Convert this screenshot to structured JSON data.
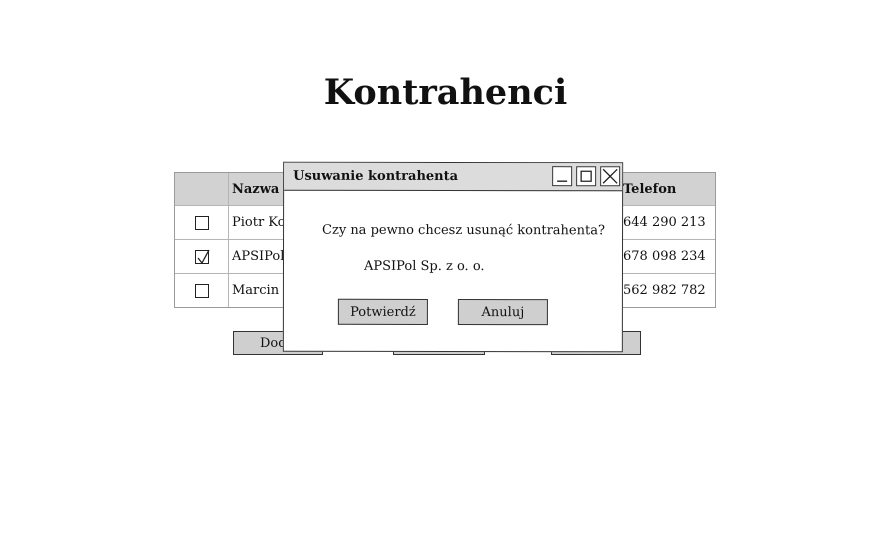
{
  "page": {
    "title": "Kontrahenci"
  },
  "table": {
    "headers": {
      "name": "Nazwa",
      "phone": "Telefon"
    },
    "rows": [
      {
        "checked": false,
        "name": "Piotr Kow",
        "phone": "644 290 213"
      },
      {
        "checked": true,
        "name": "APSIPol",
        "phone": "678 098 234"
      },
      {
        "checked": false,
        "name": "Marcin N",
        "phone": "562 982 782"
      }
    ]
  },
  "actions": {
    "add_label": "Dod"
  },
  "dialog": {
    "title": "Usuwanie kontrahenta",
    "message": "Czy na pewno chcesz usunąć kontrahenta?",
    "detail": "APSIPol Sp. z o. o.",
    "confirm_label": "Potwierdź",
    "cancel_label": "Anuluj",
    "icons": {
      "minimize": "minimize-icon",
      "maximize": "maximize-icon",
      "close": "close-icon"
    }
  }
}
